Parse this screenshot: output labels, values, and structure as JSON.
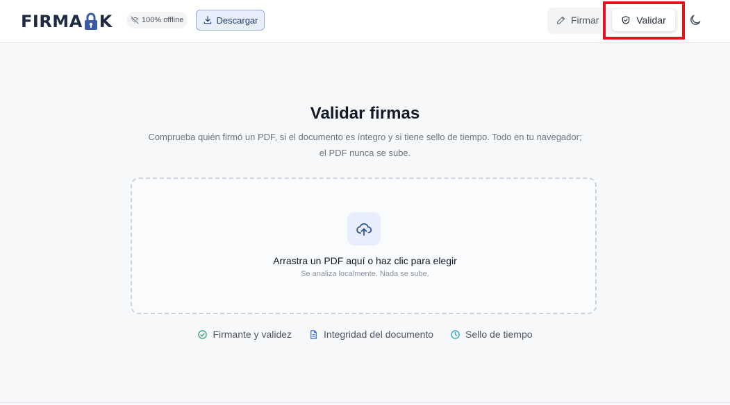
{
  "header": {
    "logo": {
      "left": "FIRMA",
      "right": "K"
    },
    "offline_badge": "100% offline",
    "download_label": "Descargar",
    "nav": {
      "sign_label": "Firmar",
      "validate_label": "Validar"
    }
  },
  "main": {
    "title": "Validar firmas",
    "subtitle_line1": "Comprueba quién firmó un PDF, si el documento es íntegro y si tiene sello de tiempo. Todo en tu navegador;",
    "subtitle_line2": "el PDF nunca se sube.",
    "dropzone": {
      "primary": "Arrastra un PDF aquí o haz clic para elegir",
      "secondary": "Se analiza localmente. Nada se sube."
    },
    "features": [
      {
        "label": "Firmante y validez",
        "icon": "check-circle-icon",
        "color": "#2e9e6b"
      },
      {
        "label": "Integridad del documento",
        "icon": "document-icon",
        "color": "#3a6fd0"
      },
      {
        "label": "Sello de tiempo",
        "icon": "clock-icon",
        "color": "#16a5c4"
      }
    ]
  },
  "colors": {
    "accent": "#3a5aa8",
    "highlight": "#e3121b",
    "background": "#f7f8fa"
  }
}
